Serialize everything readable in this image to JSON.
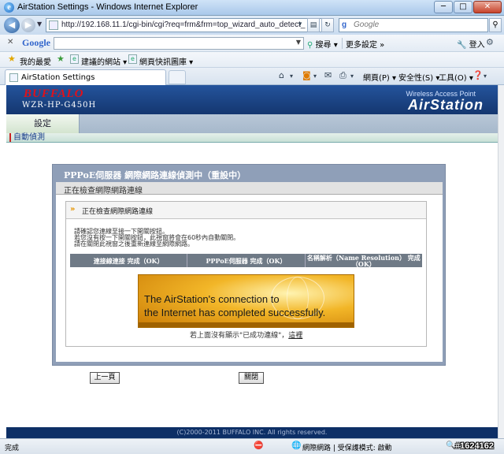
{
  "window": {
    "title": "AirStation Settings - Windows Internet Explorer",
    "min_glyph": "─",
    "max_glyph": "□",
    "close_glyph": "✕"
  },
  "address": {
    "url": "http://192.168.11.1/cgi-bin/cgi?req=frm&frm=top_wizard_auto_detect_",
    "search_placeholder": "Google"
  },
  "google_toolbar": {
    "logo": "Google",
    "search_label": "搜尋",
    "more_label": "更多設定 »",
    "login_label": "登入"
  },
  "favorites": {
    "favorites_label": "我的最愛",
    "suggested_label": "建議的網站",
    "webslice_label": "網頁快訊圖庫"
  },
  "tabs": [
    {
      "label": "AirStation Settings"
    }
  ],
  "commands": {
    "page": "網頁(P)",
    "safety": "安全性(S)",
    "tools": "工具(O)"
  },
  "banner": {
    "brand": "BUFFALO",
    "model": "WZR-HP-G450H",
    "subtitle": "Wireless Access Point",
    "product": "AirStation"
  },
  "nav": {
    "settings_tab": "設定",
    "sub_item": "自動偵測"
  },
  "wizard": {
    "title": "PPPoE伺服器 網際網路連線偵測中（重設中）",
    "subtitle": "正在檢查網際網路連線",
    "inner_heading": "正在檢查網際網路連線",
    "messages": [
      "請確認您連線至接一下開關按鈕。",
      "若您沒有按一下開關按鈕，此視窗將會在60秒內自動關閉。",
      "請在關閉此視窗之後重新連線至網際網路。"
    ],
    "status_columns": [
      "連接線連接 完成（OK）",
      "PPPoE伺服器 完成（OK）",
      "名稱解析（Name Resolution） 完成（OK）"
    ],
    "success_line1": "The AirStation's connection to",
    "success_line2": "the Internet has completed successfully.",
    "notice_text": "若上面沒有顯示\"已成功連線\"，",
    "notice_link": "這裡",
    "prev_button": "上一頁",
    "close_button": "關閉"
  },
  "footer": {
    "copyright": "(C)2000-2011 BUFFALO INC. All rights reserved."
  },
  "statusbar": {
    "done": "完成",
    "zone": "網際網路 | 受保護模式: 啟動",
    "zoom": "100%"
  },
  "watermark": "#1624162",
  "colors": {
    "banner_bg": "#1b417f",
    "brand_red": "#e0101a",
    "panel_frame": "#8f9fb8",
    "status_row": "#6f7a86",
    "success_gold": "#f2b628",
    "footer_bg": "#0d2f66"
  },
  "icons": {
    "browser": "ie-logo-icon",
    "back": "back-arrow-icon",
    "forward": "forward-arrow-icon",
    "favorites": "star-icon",
    "home": "home-icon",
    "feeds": "rss-icon",
    "print": "printer-icon",
    "help": "help-icon"
  }
}
